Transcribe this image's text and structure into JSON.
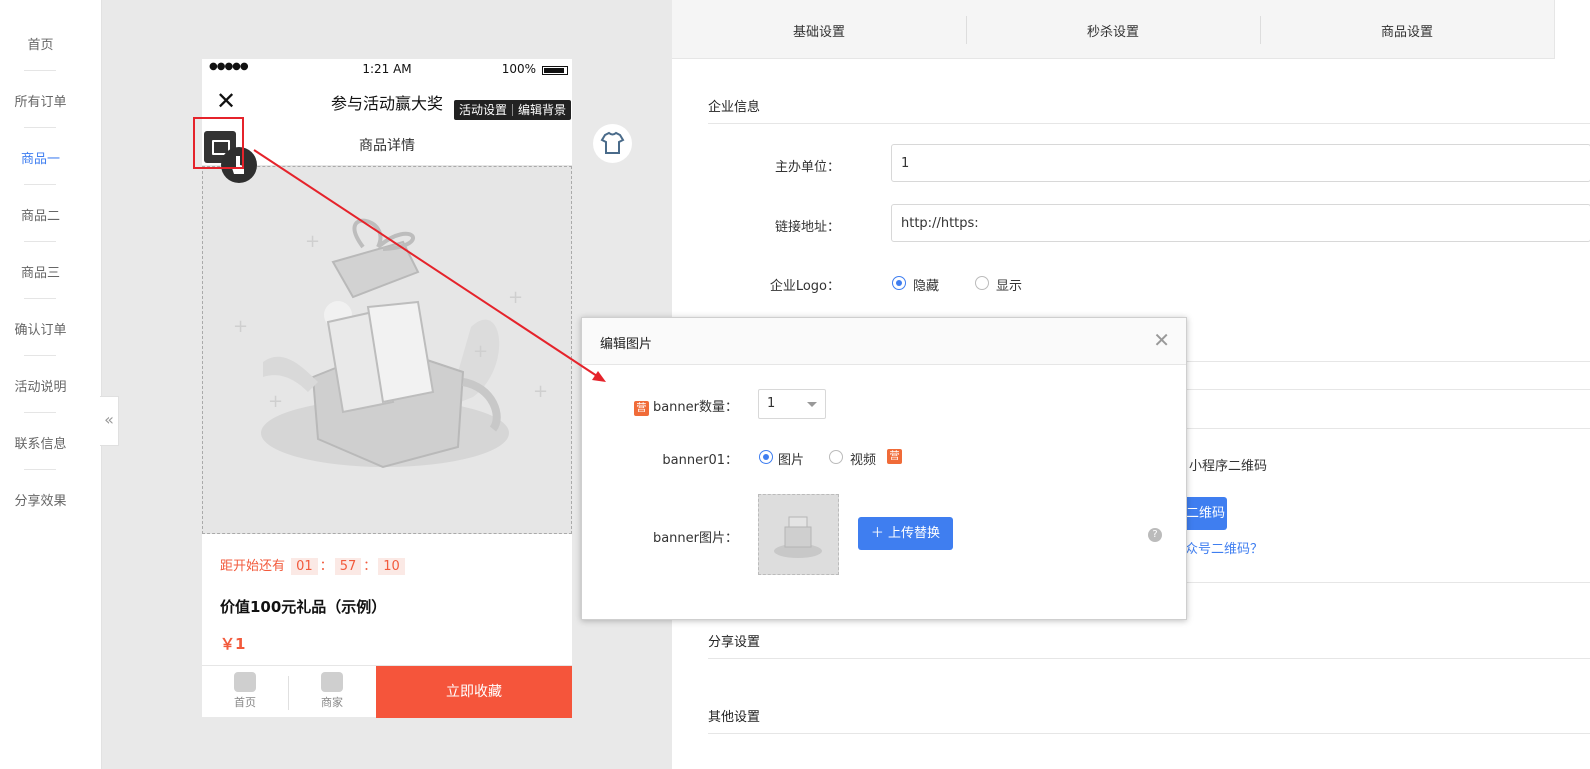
{
  "sidebar": {
    "items": [
      {
        "label": "首页",
        "active": false
      },
      {
        "label": "所有订单",
        "active": false
      },
      {
        "label": "商品一",
        "active": true
      },
      {
        "label": "商品二",
        "active": false
      },
      {
        "label": "商品三",
        "active": false
      },
      {
        "label": "确认订单",
        "active": false
      },
      {
        "label": "活动说明",
        "active": false
      },
      {
        "label": "联系信息",
        "active": false
      },
      {
        "label": "分享效果",
        "active": false
      }
    ],
    "collapse_glyph": "«"
  },
  "phone": {
    "status": {
      "signal": "●●●●●",
      "time": "1:21 AM",
      "battery": "100%"
    },
    "nav": {
      "close_glyph": "✕",
      "title": "参与活动赢大奖"
    },
    "tools": {
      "activity": "活动设置",
      "edit_bg": "编辑背景"
    },
    "detail_title": "商品详情",
    "countdown": {
      "label": "距开始还有",
      "h": "01",
      "m": "57",
      "s": "10",
      "sep": "："
    },
    "product_title": "价值100元礼品（示例）",
    "price": "￥1",
    "bottom": {
      "home": "首页",
      "shop": "商家",
      "collect": "立即收藏"
    }
  },
  "right": {
    "tabs": [
      "基础设置",
      "秒杀设置",
      "商品设置"
    ],
    "section_enterprise": "企业信息",
    "org_label": "主办单位：",
    "org_value": "1",
    "link_label": "链接地址：",
    "link_value": "http://https:",
    "logo_label": "企业Logo：",
    "logo_hide": "隐藏",
    "logo_show": "显示",
    "mini_qr": "小程序二维码",
    "qr_button": "二维码",
    "qr_link": "众号二维码？",
    "section_share": "分享设置",
    "section_other": "其他设置"
  },
  "modal": {
    "title": "编辑图片",
    "close_glyph": "✕",
    "tag": "营",
    "count_label": "banner数量：",
    "count_value": "1",
    "b01_label": "banner01：",
    "opt_image": "图片",
    "opt_video": "视频",
    "img_label": "banner图片：",
    "upload_btn": "＋ 上传替换",
    "help": "?"
  },
  "colors": {
    "accent": "#3f7ef0",
    "highlight": "#e5232b",
    "cta": "#f5553b"
  }
}
